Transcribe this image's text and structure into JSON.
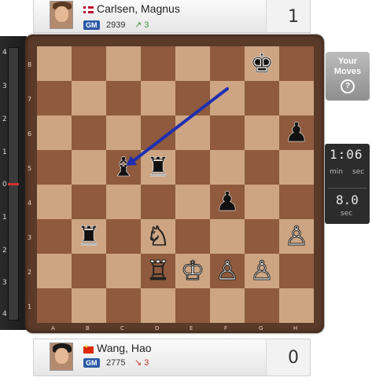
{
  "players": {
    "top": {
      "name": "Carlsen, Magnus",
      "title": "GM",
      "rating": "2939",
      "trend_symbol": "↗",
      "trend": "3",
      "score": "1",
      "flag": "norway-flag"
    },
    "bottom": {
      "name": "Wang, Hao",
      "title": "GM",
      "rating": "2775",
      "trend_symbol": "↘",
      "trend": "3",
      "score": "0",
      "flag": "china-flag"
    }
  },
  "eval_bar": {
    "ticks": [
      "4",
      "3",
      "2",
      "1",
      "0",
      "1",
      "2",
      "3",
      "4"
    ],
    "marker_value": 0
  },
  "board": {
    "ranks": [
      "8",
      "7",
      "6",
      "5",
      "4",
      "3",
      "2",
      "1"
    ],
    "files": [
      "A",
      "B",
      "C",
      "D",
      "E",
      "F",
      "G",
      "H"
    ],
    "pieces": [
      {
        "square": "g8",
        "glyph": "♚",
        "color": "black",
        "name": "black-king"
      },
      {
        "square": "h6",
        "glyph": "♟",
        "color": "black",
        "name": "black-pawn-h6"
      },
      {
        "square": "c5",
        "glyph": "♝",
        "color": "black",
        "name": "black-bishop-c5"
      },
      {
        "square": "d5",
        "glyph": "♜",
        "color": "black",
        "name": "black-rook-d5"
      },
      {
        "square": "f4",
        "glyph": "♟",
        "color": "black",
        "name": "black-pawn-f4"
      },
      {
        "square": "b3",
        "glyph": "♜",
        "color": "black",
        "name": "black-rook-b3"
      },
      {
        "square": "d3",
        "glyph": "♘",
        "color": "white",
        "name": "white-knight-d3"
      },
      {
        "square": "h3",
        "glyph": "♙",
        "color": "white",
        "name": "white-pawn-h3"
      },
      {
        "square": "d2",
        "glyph": "♖",
        "color": "white",
        "name": "white-rook-d2"
      },
      {
        "square": "e2",
        "glyph": "♔",
        "color": "white",
        "name": "white-king"
      },
      {
        "square": "f2",
        "glyph": "♙",
        "color": "white",
        "name": "white-pawn-f2"
      },
      {
        "square": "g2",
        "glyph": "♙",
        "color": "white",
        "name": "white-pawn-g2"
      }
    ],
    "arrow": {
      "from": "f7",
      "to": "c5",
      "color": "#1f2fb0"
    }
  },
  "your_moves": {
    "label_line1": "Your",
    "label_line2": "Moves",
    "help": "?"
  },
  "clock": {
    "time": "1:06",
    "min_label": "min",
    "sec_label": "sec",
    "move_time": "8.0",
    "move_sec_label": "sec"
  }
}
